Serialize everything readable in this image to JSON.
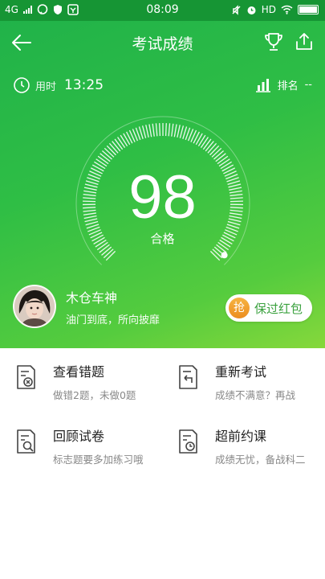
{
  "status_bar": {
    "network": "4G",
    "time": "08:09",
    "hd": "HD"
  },
  "header": {
    "title": "考试成绩"
  },
  "stats": {
    "time_label": "用时",
    "time_value": "13:25",
    "rank_label": "排名",
    "rank_value": "--"
  },
  "result": {
    "score": "98",
    "grade": "合格"
  },
  "user": {
    "name": "木仓车神",
    "motto": "油门到底，所向披靡"
  },
  "promo": {
    "badge": "抢",
    "label": "保过红包"
  },
  "actions": [
    {
      "title": "查看错题",
      "subtitle": "做错2题，未做0题"
    },
    {
      "title": "重新考试",
      "subtitle": "成绩不满意？再战"
    },
    {
      "title": "回顾试卷",
      "subtitle": "标志题要多加练习哦"
    },
    {
      "title": "超前约课",
      "subtitle": "成绩无忧，备战科二"
    }
  ]
}
